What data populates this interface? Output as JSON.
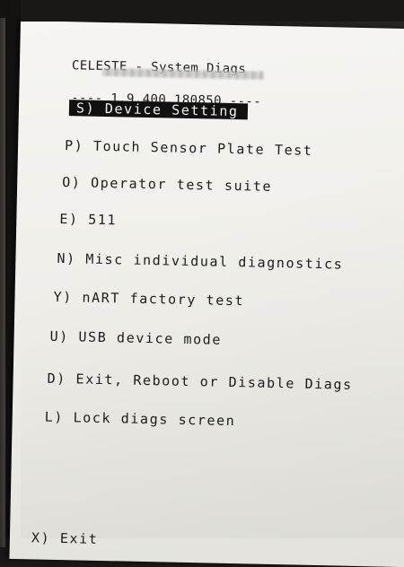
{
  "header": {
    "title_line": "CELESTE - System Diags",
    "version_line": "---- 1.9.400.180850 ----"
  },
  "menu": {
    "items": [
      {
        "label": "S) Device Setting",
        "selected": true
      },
      {
        "label": "P) Touch Sensor Plate Test",
        "selected": false
      },
      {
        "label": "O) Operator test suite",
        "selected": false
      },
      {
        "label": "E) 511",
        "selected": false
      },
      {
        "label": "N) Misc individual diagnostics",
        "selected": false
      },
      {
        "label": "Y) nART factory test",
        "selected": false
      },
      {
        "label": "U) USB device mode",
        "selected": false
      },
      {
        "label": "D) Exit, Reboot or Disable Diags",
        "selected": false
      },
      {
        "label": "L) Lock diags screen",
        "selected": false
      }
    ],
    "footer_partial": "X) Exit"
  },
  "colors": {
    "screen_background": "#f1f0eb",
    "text": "#1c1c1c",
    "selection_background": "#111111",
    "selection_text": "#f4f4f0",
    "bezel": "#1b1917"
  }
}
